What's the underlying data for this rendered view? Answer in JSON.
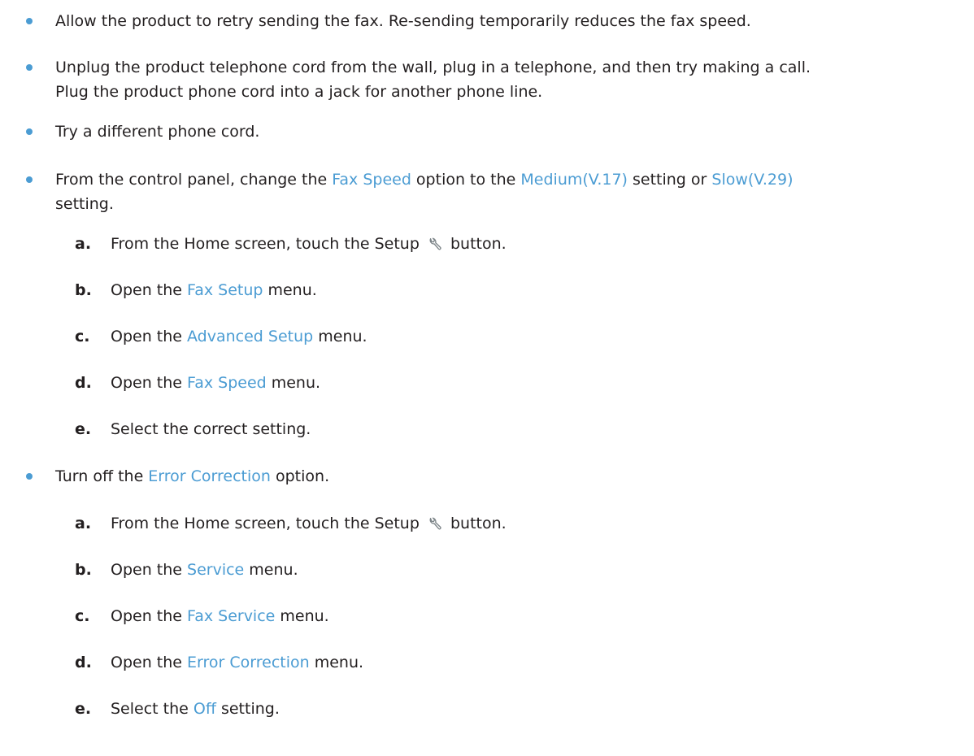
{
  "bullets": [
    {
      "text": "Allow the product to retry sending the fax. Re-sending temporarily reduces the fax speed."
    },
    {
      "line1": "Unplug the product telephone cord from the wall, plug in a telephone, and then try making a call.",
      "line2": "Plug the product phone cord into a jack for another phone line."
    },
    {
      "text": "Try a different phone cord."
    },
    {
      "pre": "From the control panel, change the ",
      "ui1": "Fax Speed",
      "mid1": " option to the ",
      "ui2": "Medium(V.17)",
      "mid2": " setting or ",
      "ui3": "Slow(V.29)",
      "line2": "setting."
    },
    {
      "pre": "Turn off the ",
      "ui": "Error Correction",
      "post": " option."
    }
  ],
  "steps_speed": [
    {
      "letter": "a.",
      "pre": "From the Home screen, touch the Setup ",
      "icon": "wrench-icon",
      "post": " button."
    },
    {
      "letter": "b.",
      "pre": "Open the ",
      "ui": "Fax Setup",
      "post": " menu."
    },
    {
      "letter": "c.",
      "pre": "Open the ",
      "ui": "Advanced Setup",
      "post": " menu."
    },
    {
      "letter": "d.",
      "pre": "Open the ",
      "ui": "Fax Speed",
      "post": " menu."
    },
    {
      "letter": "e.",
      "text": "Select the correct setting."
    }
  ],
  "steps_error": [
    {
      "letter": "a.",
      "pre": "From the Home screen, touch the Setup ",
      "icon": "wrench-icon",
      "post": " button."
    },
    {
      "letter": "b.",
      "pre": "Open the ",
      "ui": "Service",
      "post": " menu."
    },
    {
      "letter": "c.",
      "pre": "Open the ",
      "ui": "Fax Service",
      "post": " menu."
    },
    {
      "letter": "d.",
      "pre": "Open the ",
      "ui": "Error Correction",
      "post": " menu."
    },
    {
      "letter": "e.",
      "pre": "Select the ",
      "ui": "Off",
      "post": " setting."
    }
  ],
  "colors": {
    "accent": "#4b9cd3",
    "text": "#231f20"
  }
}
